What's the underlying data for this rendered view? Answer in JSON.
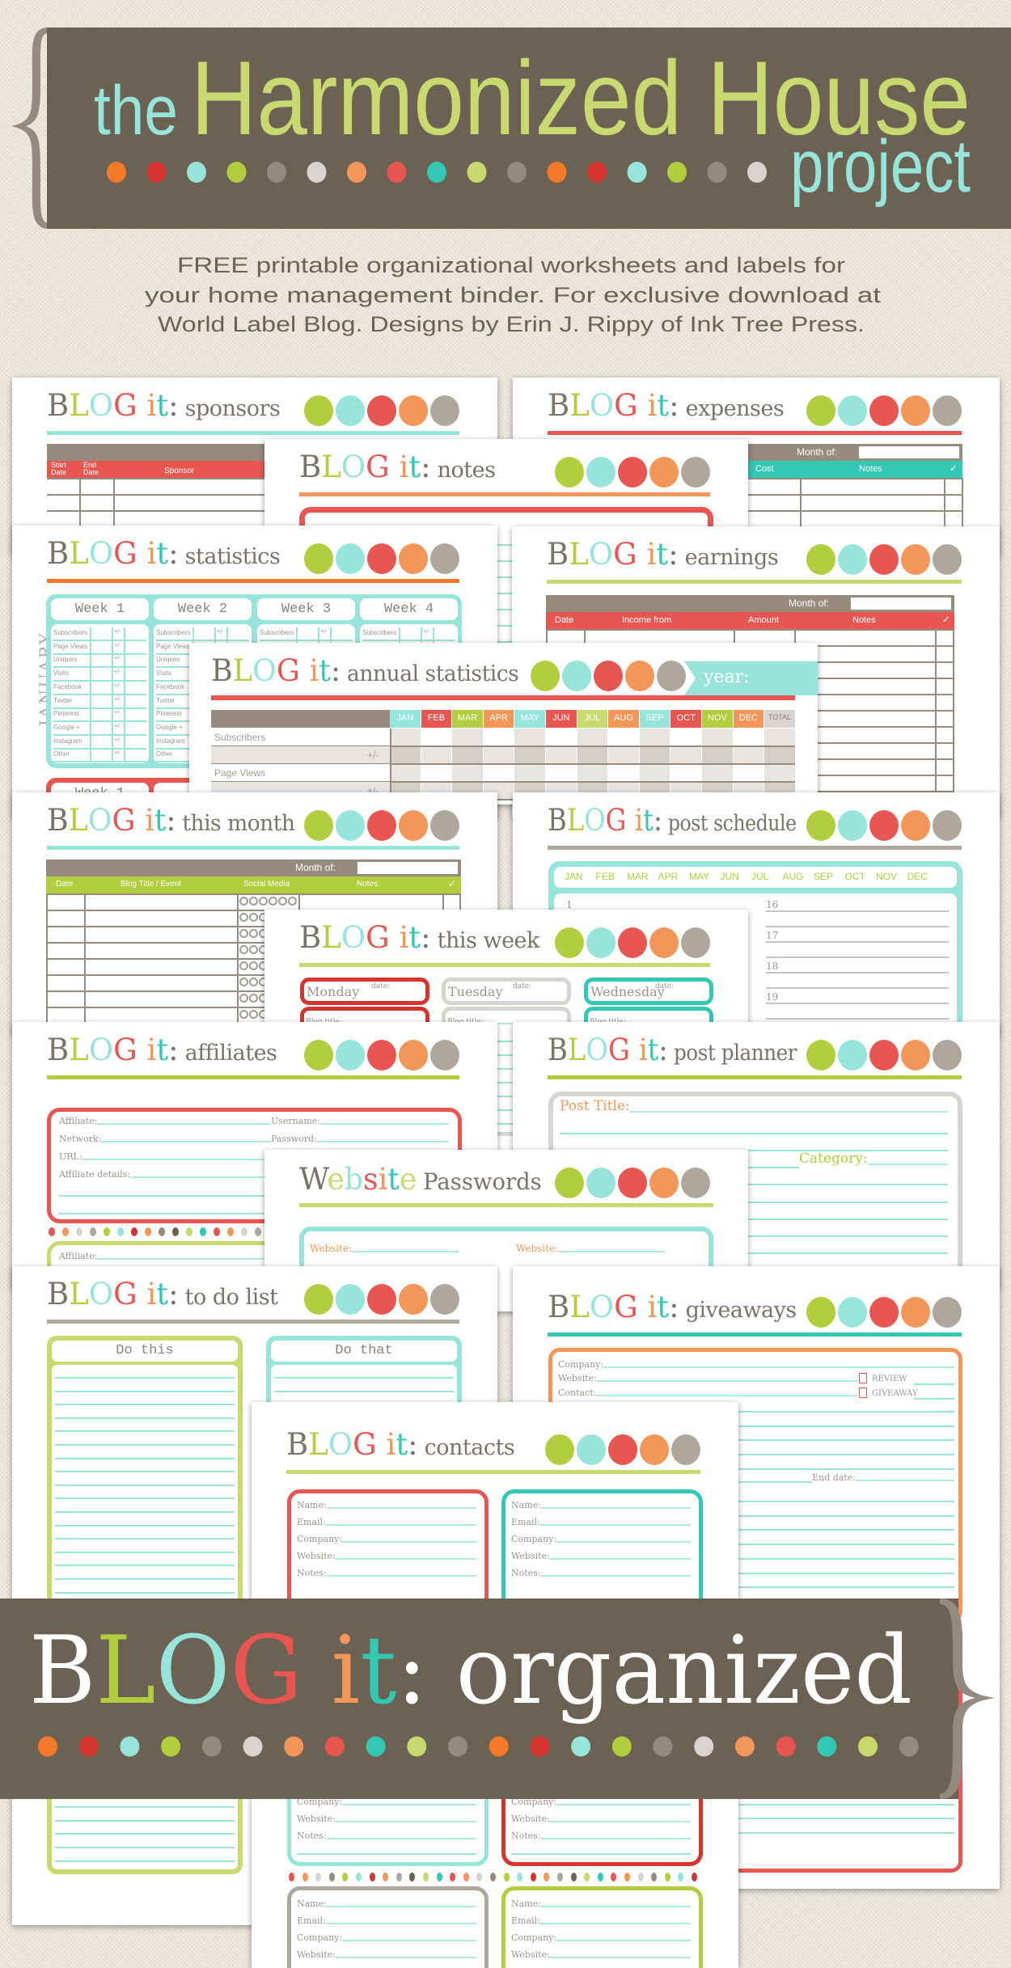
{
  "palette": {
    "banner": "#6c6253",
    "brace": "#948a80",
    "taupe": "#978b7e",
    "gray": "#afa79c",
    "lightgray": "#d8d4cf",
    "green": "#b2cd3d",
    "lightgreen": "#c8d96f",
    "cyan": "#97e4da",
    "red": "#e85651",
    "darkred": "#d6342f",
    "orange": "#f39659",
    "darkorange": "#f47a2a",
    "teal": "#33c8b4",
    "lettering": "#7b7268",
    "label": "#9b948c",
    "background": "#ece6da"
  },
  "header": {
    "title_the": "the",
    "title_main": "Harmonized House",
    "title_project": "project",
    "dot_colors": [
      "#f47a2a",
      "#d6342f",
      "#97e4da",
      "#b2cd3d",
      "#948a80",
      "#d8d4cf",
      "#f39659",
      "#e85651",
      "#33c8b4",
      "#c8d96f",
      "#948a80",
      "#f47a2a",
      "#d6342f",
      "#97e4da",
      "#b2cd3d",
      "#948a80",
      "#d8d4cf"
    ]
  },
  "subtitle": [
    "FREE printable organizational worksheets and labels for",
    "your home management binder.  For exclusive download at",
    "World Label Blog.  Designs by Erin J. Rippy of Ink Tree Press."
  ],
  "brand": "BLOG it:",
  "sheets": {
    "sponsors": {
      "title": "sponsors",
      "columns": [
        "Start Date",
        "End Date",
        "Sponsor"
      ]
    },
    "expenses": {
      "title": "expenses",
      "month_label": "Month of:",
      "columns": [
        "Cost",
        "Notes",
        "✓"
      ]
    },
    "notes": {
      "title": "notes"
    },
    "statistics": {
      "title": "statistics",
      "month": "JANUARY",
      "weeks": [
        "Week 1",
        "Week 2",
        "Week 3",
        "Week 4"
      ],
      "rows": [
        "Subscribers",
        "Page Views",
        "Uniques",
        "Visits",
        "Facebook",
        "Twitter",
        "Pinterest",
        "Google +",
        "Instagram",
        "Other"
      ],
      "delta": "+/-",
      "next_week": "Week 1"
    },
    "earnings": {
      "title": "earnings",
      "month_label": "Month of:",
      "columns": [
        "Date",
        "Income from",
        "Amount",
        "Notes",
        "✓"
      ]
    },
    "annual": {
      "title": "annual statistics",
      "year_label": "year:",
      "months": [
        "JAN",
        "FEB",
        "MAR",
        "APR",
        "MAY",
        "JUN",
        "JUL",
        "AUG",
        "SEP",
        "OCT",
        "NOV",
        "DEC",
        "TOTAL"
      ],
      "rows": [
        "Subscribers",
        "+/-",
        "Page Views",
        "+/-"
      ]
    },
    "this_month": {
      "title": "this month",
      "month_label": "Month of:",
      "columns": [
        "Date",
        "Blog Title / Event",
        "Social Media",
        "Notes",
        "✓"
      ]
    },
    "post_schedule": {
      "title": "post schedule",
      "months": [
        "JAN",
        "FEB",
        "MAR",
        "APR",
        "MAY",
        "JUN",
        "JUL",
        "AUG",
        "SEP",
        "OCT",
        "NOV",
        "DEC"
      ],
      "days": [
        "1",
        "16",
        "17",
        "18",
        "19"
      ]
    },
    "this_week": {
      "title": "this week",
      "days": [
        "Monday",
        "Tuesday",
        "Wednesday"
      ],
      "date_label": "date:",
      "blog_title_label": "Blog title:"
    },
    "affiliates": {
      "title": "affiliates",
      "fields_left": [
        "Affiliate:",
        "Network:",
        "URL:",
        "Affiliate details:"
      ],
      "fields_right": [
        "Username:",
        "Password:"
      ],
      "second_affiliate": "Affiliate:"
    },
    "post_planner": {
      "title": "post planner",
      "post_title": "Post Title:",
      "category": "Category:"
    },
    "passwords": {
      "title_word1": "Website",
      "title_word2": "Passwords",
      "website_label": "Website:"
    },
    "todo": {
      "title": "to do list",
      "columns": [
        "Do this",
        "Do that"
      ]
    },
    "giveaways": {
      "title": "giveaways",
      "fields": [
        "Company:",
        "Website:",
        "Contact:"
      ],
      "checkboxes": [
        "REVIEW",
        "GIVEAWAY"
      ],
      "end_date": "End date:"
    },
    "contacts": {
      "title": "contacts",
      "fields": [
        "Name:",
        "Email:",
        "Company:",
        "Website:",
        "Notes:"
      ]
    }
  },
  "footer": {
    "brand": "BLOG it:",
    "word": "organized",
    "dot_colors": [
      "#f47a2a",
      "#d6342f",
      "#97e4da",
      "#b2cd3d",
      "#948a80",
      "#d8d4cf",
      "#f39659",
      "#e85651",
      "#33c8b4",
      "#c8d96f",
      "#948a80",
      "#f47a2a",
      "#d6342f",
      "#97e4da",
      "#b2cd3d",
      "#948a80",
      "#d8d4cf",
      "#f39659",
      "#e85651",
      "#33c8b4",
      "#c8d96f",
      "#948a80"
    ]
  }
}
